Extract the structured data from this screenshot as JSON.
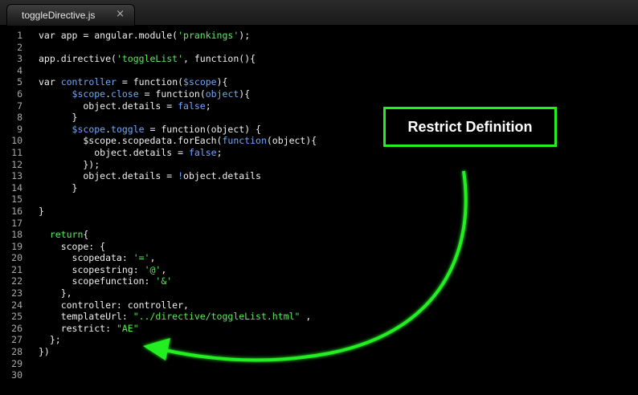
{
  "tab": {
    "title": "toggleDirective.js",
    "close_glyph": "×"
  },
  "callout": {
    "text": "Restrict Definition"
  },
  "colors": {
    "accent_green": "#22ee22",
    "string": "#5de85d",
    "scope": "#6fa7ff",
    "background": "#000000"
  },
  "code": {
    "lines": [
      {
        "n": "1",
        "tokens": [
          [
            "p",
            "var app = angular.module("
          ],
          [
            "s",
            "'prankings'"
          ],
          [
            "p",
            ");"
          ]
        ]
      },
      {
        "n": "2",
        "tokens": []
      },
      {
        "n": "3",
        "tokens": [
          [
            "p",
            "app.directive("
          ],
          [
            "s",
            "'toggleList'"
          ],
          [
            "p",
            ", function(){"
          ]
        ]
      },
      {
        "n": "4",
        "tokens": []
      },
      {
        "n": "5",
        "tokens": [
          [
            "p",
            "var "
          ],
          [
            "v",
            "controller"
          ],
          [
            "p",
            " = function("
          ],
          [
            "v",
            "$scope"
          ],
          [
            "p",
            "){"
          ]
        ]
      },
      {
        "n": "6",
        "tokens": [
          [
            "p",
            "      "
          ],
          [
            "v",
            "$scope"
          ],
          [
            "p",
            "."
          ],
          [
            "v",
            "close"
          ],
          [
            "p",
            " = function("
          ],
          [
            "v",
            "object"
          ],
          [
            "p",
            "){"
          ]
        ]
      },
      {
        "n": "7",
        "tokens": [
          [
            "p",
            "        object.details = "
          ],
          [
            "v",
            "false"
          ],
          [
            "p",
            ";"
          ]
        ]
      },
      {
        "n": "8",
        "tokens": [
          [
            "p",
            "      }"
          ]
        ]
      },
      {
        "n": "9",
        "tokens": [
          [
            "p",
            "      "
          ],
          [
            "v",
            "$scope"
          ],
          [
            "p",
            "."
          ],
          [
            "v",
            "toggle"
          ],
          [
            "p",
            " = function(object) {"
          ]
        ]
      },
      {
        "n": "10",
        "tokens": [
          [
            "p",
            "        $scope.scopedata.forEach("
          ],
          [
            "v",
            "function"
          ],
          [
            "p",
            "(object){"
          ]
        ]
      },
      {
        "n": "11",
        "tokens": [
          [
            "p",
            "          object.details = "
          ],
          [
            "v",
            "false"
          ],
          [
            "p",
            ";"
          ]
        ]
      },
      {
        "n": "12",
        "tokens": [
          [
            "p",
            "        });"
          ]
        ]
      },
      {
        "n": "13",
        "tokens": [
          [
            "p",
            "        object.details = "
          ],
          [
            "v",
            "!"
          ],
          [
            "p",
            "object.details"
          ]
        ]
      },
      {
        "n": "14",
        "tokens": [
          [
            "p",
            "      }"
          ]
        ]
      },
      {
        "n": "15",
        "tokens": []
      },
      {
        "n": "16",
        "tokens": [
          [
            "p",
            "}"
          ]
        ]
      },
      {
        "n": "17",
        "tokens": []
      },
      {
        "n": "18",
        "tokens": [
          [
            "p",
            "  "
          ],
          [
            "s",
            "return"
          ],
          [
            "p",
            "{"
          ]
        ]
      },
      {
        "n": "19",
        "tokens": [
          [
            "p",
            "    scope: {"
          ]
        ]
      },
      {
        "n": "20",
        "tokens": [
          [
            "p",
            "      scopedata: "
          ],
          [
            "s",
            "'='"
          ],
          [
            "p",
            ","
          ]
        ]
      },
      {
        "n": "21",
        "tokens": [
          [
            "p",
            "      scopestring: "
          ],
          [
            "s",
            "'@'"
          ],
          [
            "p",
            ","
          ]
        ]
      },
      {
        "n": "22",
        "tokens": [
          [
            "p",
            "      scopefunction: "
          ],
          [
            "s",
            "'&'"
          ]
        ]
      },
      {
        "n": "23",
        "tokens": [
          [
            "p",
            "    },"
          ]
        ]
      },
      {
        "n": "24",
        "tokens": [
          [
            "p",
            "    controller: controller,"
          ]
        ]
      },
      {
        "n": "25",
        "tokens": [
          [
            "p",
            "    templateUrl: "
          ],
          [
            "s",
            "\"../directive/toggleList.html\""
          ],
          [
            "p",
            " ,"
          ]
        ]
      },
      {
        "n": "26",
        "tokens": [
          [
            "p",
            "    restrict: "
          ],
          [
            "s",
            "\"AE\""
          ]
        ]
      },
      {
        "n": "27",
        "tokens": [
          [
            "p",
            "  };"
          ]
        ]
      },
      {
        "n": "28",
        "tokens": [
          [
            "p",
            "})"
          ]
        ]
      },
      {
        "n": "29",
        "tokens": []
      },
      {
        "n": "30",
        "tokens": []
      }
    ]
  }
}
